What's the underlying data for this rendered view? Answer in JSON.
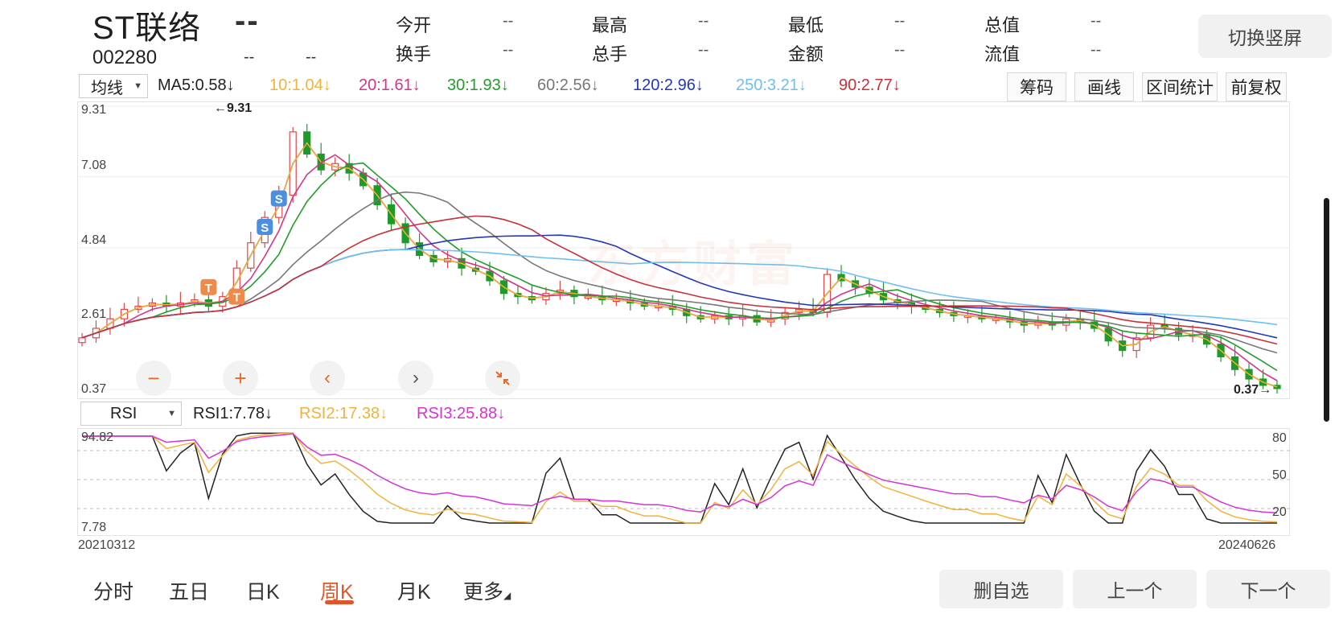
{
  "header": {
    "name": "ST联络",
    "price": "--",
    "code": "002280",
    "change": "--",
    "change_pct": "--",
    "quotes": [
      {
        "label": "今开",
        "value": "--"
      },
      {
        "label": "最高",
        "value": "--"
      },
      {
        "label": "最低",
        "value": "--"
      },
      {
        "label": "总值",
        "value": "--"
      },
      {
        "label": "换手",
        "value": "--"
      },
      {
        "label": "总手",
        "value": "--"
      },
      {
        "label": "金额",
        "value": "--"
      },
      {
        "label": "流值",
        "value": "--"
      }
    ],
    "rotate_button": "切换竖屏"
  },
  "indicator_bar": {
    "type_select": "均线",
    "ma": [
      {
        "text": "MA5:0.58↓",
        "color": "#222222"
      },
      {
        "text": "10:1.04↓",
        "color": "#f4b23a"
      },
      {
        "text": "20:1.61↓",
        "color": "#d6338a"
      },
      {
        "text": "30:1.93↓",
        "color": "#1f9e2a"
      },
      {
        "text": "60:2.56↓",
        "color": "#777777"
      },
      {
        "text": "120:2.96↓",
        "color": "#2238b8"
      },
      {
        "text": "250:3.21↓",
        "color": "#6ec0f0"
      },
      {
        "text": "90:2.77↓",
        "color": "#c7303a"
      }
    ],
    "tools": [
      "筹码",
      "画线",
      "区间统计",
      "前复权"
    ]
  },
  "main_chart": {
    "y_ticks": [
      "9.31",
      "7.08",
      "4.84",
      "2.61",
      "0.37"
    ],
    "high_label": "9.31",
    "low_label": "0.37",
    "markers": [
      "S",
      "S",
      "T",
      "T"
    ],
    "watermark": "东方财富"
  },
  "rsi_bar": {
    "type_select": "RSI",
    "items": [
      {
        "text": "RSI1:7.78↓",
        "color": "#222222"
      },
      {
        "text": "RSI2:17.38↓",
        "color": "#f4b23a"
      },
      {
        "text": "RSI3:25.88↓",
        "color": "#d633d6"
      }
    ]
  },
  "rsi_chart": {
    "left_top": "94.82",
    "left_bottom": "7.78",
    "right_ticks": [
      "80",
      "50",
      "20"
    ],
    "date_start": "20210312",
    "date_end": "20240626"
  },
  "bottom": {
    "periods": [
      "分时",
      "五日",
      "日K",
      "周K",
      "月K",
      "更多"
    ],
    "active_period": "周K",
    "buttons": [
      "删自选",
      "上一个",
      "下一个"
    ]
  },
  "chart_data": {
    "type": "candlestick",
    "timeframe": "weekly",
    "x_range": [
      "20210312",
      "20240626"
    ],
    "ylim": [
      0.37,
      9.31
    ],
    "y_ticks": [
      9.31,
      7.08,
      4.84,
      2.61,
      0.37
    ],
    "close_path": [
      2.0,
      2.3,
      2.6,
      2.9,
      3.0,
      3.1,
      3.0,
      3.1,
      3.2,
      3.0,
      3.3,
      4.2,
      5.0,
      5.8,
      6.5,
      8.5,
      7.8,
      7.3,
      7.5,
      7.2,
      6.8,
      6.2,
      5.6,
      5.0,
      4.6,
      4.4,
      4.5,
      4.2,
      4.1,
      3.8,
      3.4,
      3.3,
      3.2,
      3.4,
      3.5,
      3.3,
      3.3,
      3.2,
      3.2,
      3.1,
      3.0,
      3.0,
      2.9,
      2.7,
      2.6,
      2.7,
      2.6,
      2.7,
      2.5,
      2.6,
      2.8,
      2.9,
      2.8,
      4.0,
      3.8,
      3.6,
      3.4,
      3.2,
      3.1,
      3.0,
      2.9,
      2.8,
      2.7,
      2.7,
      2.6,
      2.6,
      2.5,
      2.4,
      2.5,
      2.4,
      2.6,
      2.5,
      2.3,
      1.9,
      1.6,
      2.0,
      2.4,
      2.3,
      2.1,
      2.1,
      1.8,
      1.4,
      1.0,
      0.7,
      0.5,
      0.4
    ],
    "ma_last": {
      "MA5": 0.58,
      "MA10": 1.04,
      "MA20": 1.61,
      "MA30": 1.93,
      "MA60": 2.56,
      "MA120": 2.96,
      "MA250": 3.21,
      "MA90": 2.77
    },
    "rsi_last": {
      "RSI1": 7.78,
      "RSI2": 17.38,
      "RSI3": 25.88
    },
    "rsi_range": [
      7.78,
      94.82
    ]
  }
}
